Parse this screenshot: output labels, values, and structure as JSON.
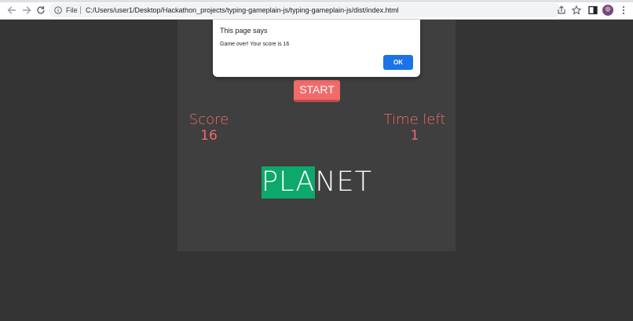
{
  "browser": {
    "file_label": "File",
    "url": "C:/Users/user1/Desktop/Hackathon_projects/typing-gameplain-js/typing-gameplain-js/dist/index.html",
    "icons": [
      "back-icon",
      "forward-icon",
      "reload-icon",
      "info-icon",
      "share-icon",
      "star-icon",
      "side-panel-icon",
      "avatar",
      "menu-icon"
    ]
  },
  "game": {
    "start_label": "START",
    "score_label": "Score",
    "score_value": "16",
    "time_label": "Time left",
    "time_value": "1",
    "word_typed": "PLA",
    "word_remaining": "NET",
    "accent_color": "#f26b6b",
    "typed_color": "#0da86b"
  },
  "dialog": {
    "title": "This page says",
    "message": "Game over! Your score is 16",
    "ok_label": "OK",
    "ok_color": "#1a73e8"
  }
}
